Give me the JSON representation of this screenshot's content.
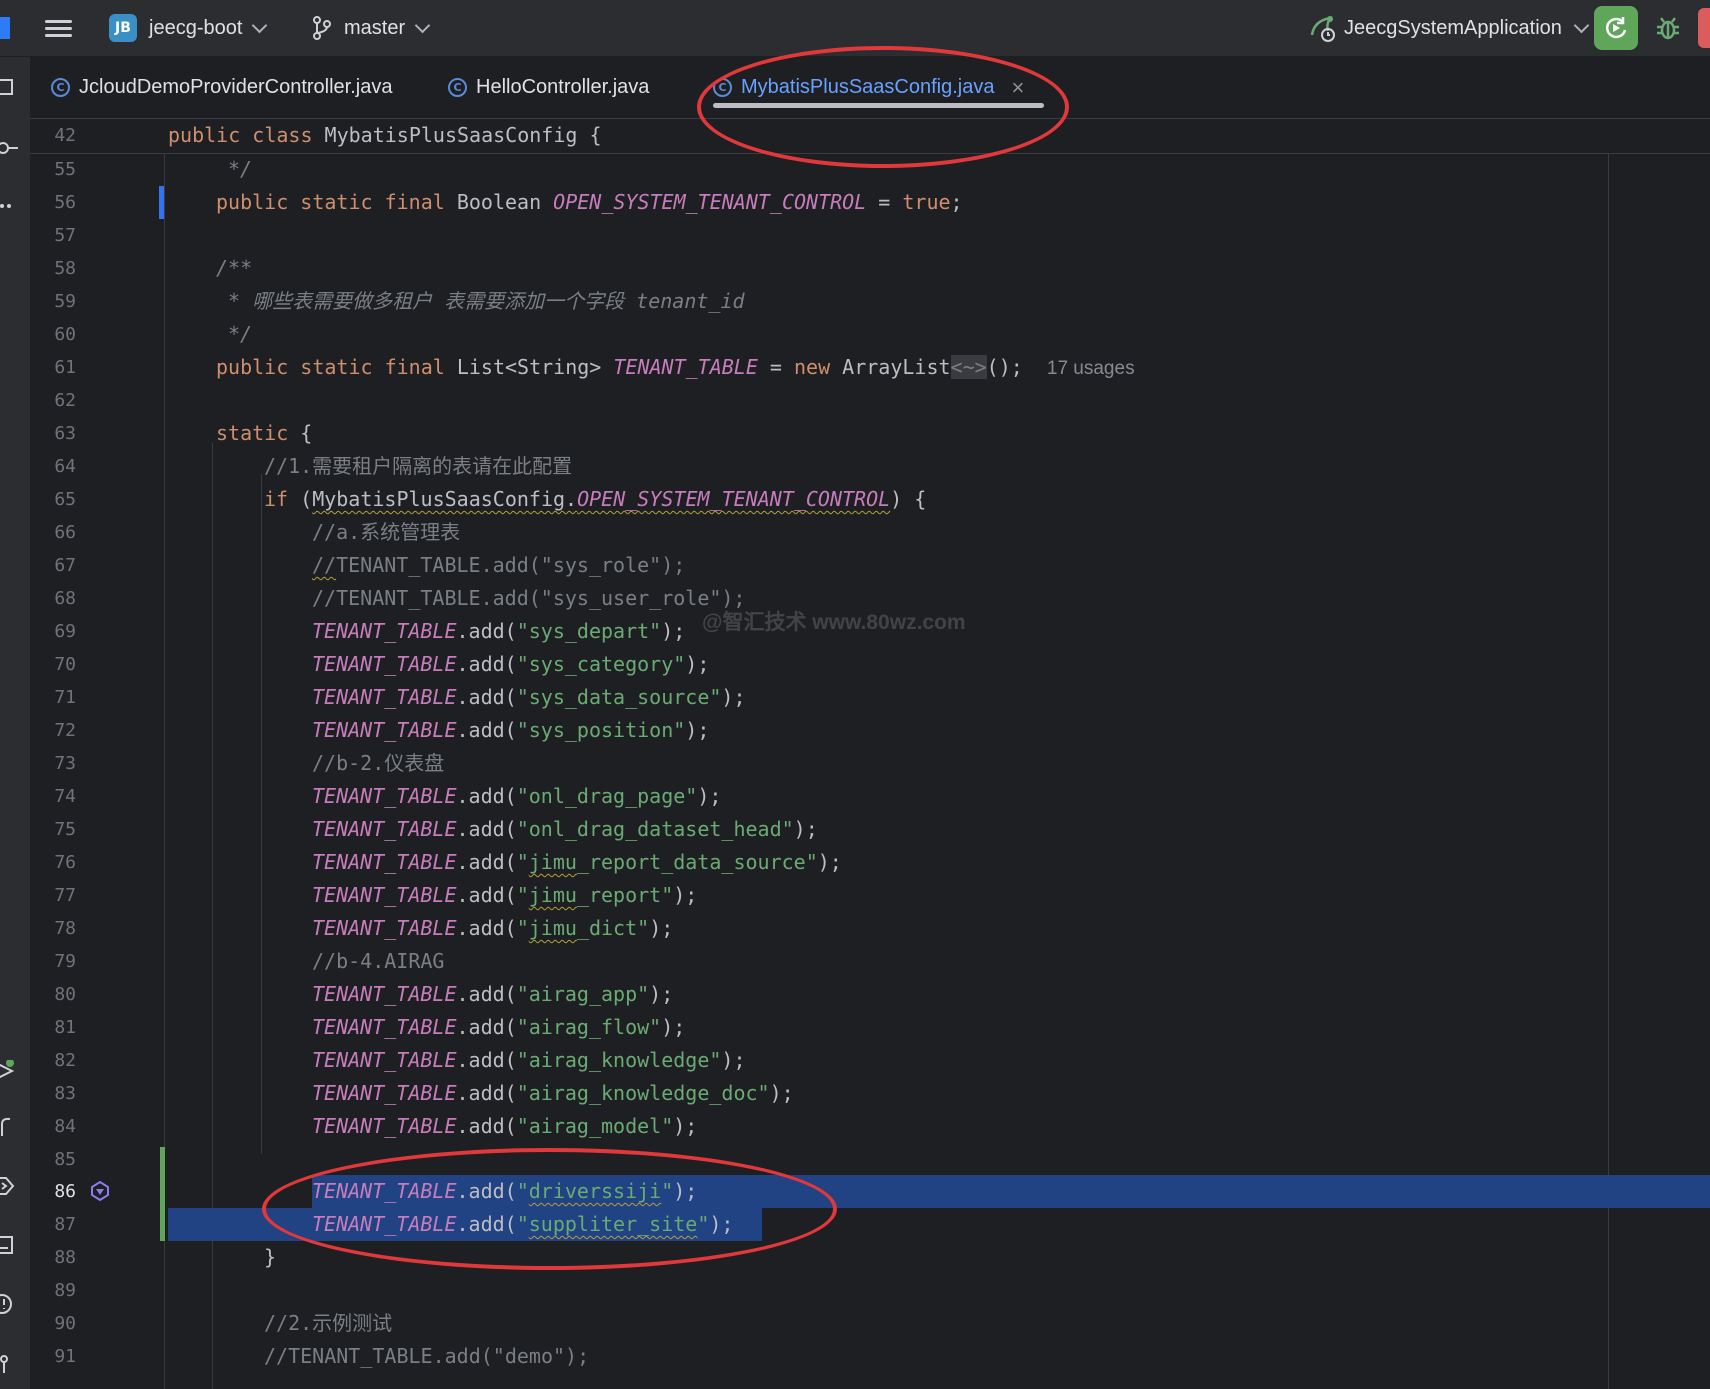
{
  "titlebar": {
    "project_badge": "JB",
    "project_name": "jeecg-boot",
    "branch": "master",
    "run_config": "JeecgSystemApplication"
  },
  "tabs": [
    {
      "label": "JcloudDemoProviderController.java",
      "icon": "class-icon",
      "glyph": "C",
      "active": false
    },
    {
      "label": "HelloController.java",
      "icon": "class-icon",
      "glyph": "C",
      "active": false
    },
    {
      "label": "MybatisPlusSaasConfig.java",
      "icon": "class-icon",
      "glyph": "C",
      "active": true
    }
  ],
  "tab_close_glyph": "×",
  "editor": {
    "sticky_line": {
      "num": "42",
      "code": "public class MybatisPlusSaasConfig {"
    },
    "lines": [
      {
        "num": "55"
      },
      {
        "num": "56"
      },
      {
        "num": "57"
      },
      {
        "num": "58"
      },
      {
        "num": "59"
      },
      {
        "num": "60"
      },
      {
        "num": "61"
      },
      {
        "num": "62"
      },
      {
        "num": "63"
      },
      {
        "num": "64"
      },
      {
        "num": "65"
      },
      {
        "num": "66"
      },
      {
        "num": "67"
      },
      {
        "num": "68"
      },
      {
        "num": "69"
      },
      {
        "num": "70"
      },
      {
        "num": "71"
      },
      {
        "num": "72"
      },
      {
        "num": "73"
      },
      {
        "num": "74"
      },
      {
        "num": "75"
      },
      {
        "num": "76"
      },
      {
        "num": "77"
      },
      {
        "num": "78"
      },
      {
        "num": "79"
      },
      {
        "num": "80"
      },
      {
        "num": "81"
      },
      {
        "num": "82"
      },
      {
        "num": "83"
      },
      {
        "num": "84"
      },
      {
        "num": "85"
      },
      {
        "num": "86"
      },
      {
        "num": "87"
      },
      {
        "num": "88"
      },
      {
        "num": "89"
      },
      {
        "num": "90"
      },
      {
        "num": "91"
      }
    ],
    "tokens": {
      "comment_end": "*/",
      "kw_public_static_final": "public static final",
      "type_boolean": "Boolean",
      "open_control_field": "OPEN_SYSTEM_TENANT_CONTROL",
      "assign": " = ",
      "kw_true": "true",
      "semicolon": ";",
      "javadoc_start": "/**",
      "javadoc_body": "* 哪些表需要做多租户 表需要添加一个字段 tenant_id",
      "list_string": "List<String>",
      "tenant_table": "TENANT_TABLE",
      "kw_new": "new",
      "arraylist": "ArrayList",
      "diamond": "<~>",
      "call_end": "();",
      "usages_hint": "17 usages",
      "kw_static": "static",
      "brace_open": "{",
      "brace_close": "}",
      "comment_1": "//1.需要租户隔离的表请在此配置",
      "kw_if": "if",
      "paren_open": "(",
      "class_ref": "MybatisPlusSaasConfig.",
      "paren_close_brace": ") {",
      "comment_a": "//a.系统管理表",
      "comment_sys_role_slash": "//",
      "comment_sys_role_rest": "TENANT_TABLE.add(\"sys_role\");",
      "comment_sys_user_role": "//TENANT_TABLE.add(\"sys_user_role\");",
      "add_open": ".add(",
      "add_close": ");",
      "str_sys_depart": "\"sys_depart\"",
      "str_sys_category": "\"sys_category\"",
      "str_sys_data_source": "\"sys_data_source\"",
      "str_sys_position": "\"sys_position\"",
      "comment_b2": "//b-2.仪表盘",
      "str_onl_drag_page": "\"onl_drag_page\"",
      "str_onl_drag_dataset_head": "\"onl_drag_dataset_head\"",
      "quote": "\"",
      "jimu": "jimu",
      "rest_report_data_source": "_report_data_source\"",
      "rest_report": "_report\"",
      "rest_dict": "_dict\"",
      "comment_b4": "//b-4.AIRAG",
      "str_airag_app": "\"airag_app\"",
      "str_airag_flow": "\"airag_flow\"",
      "str_airag_knowledge": "\"airag_knowledge\"",
      "str_airag_knowledge_doc": "\"airag_knowledge_doc\"",
      "str_airag_model": "\"airag_model\"",
      "driverssiji": "driverssiji",
      "suppliter_site": "suppliter_site",
      "comment_2": "//2.示例测试",
      "comment_demo": "//TENANT_TABLE.add(\"demo\");"
    }
  },
  "watermark": "@智汇技术 www.80wz.com",
  "colors": {
    "background": "#1e1f22",
    "keyword": "#cf8e6d",
    "string": "#6aab73",
    "static_field": "#c77dbb",
    "comment": "#7a7e85",
    "selection": "#214283",
    "annotation": "#e0383b",
    "run_button": "#5fa65a"
  }
}
